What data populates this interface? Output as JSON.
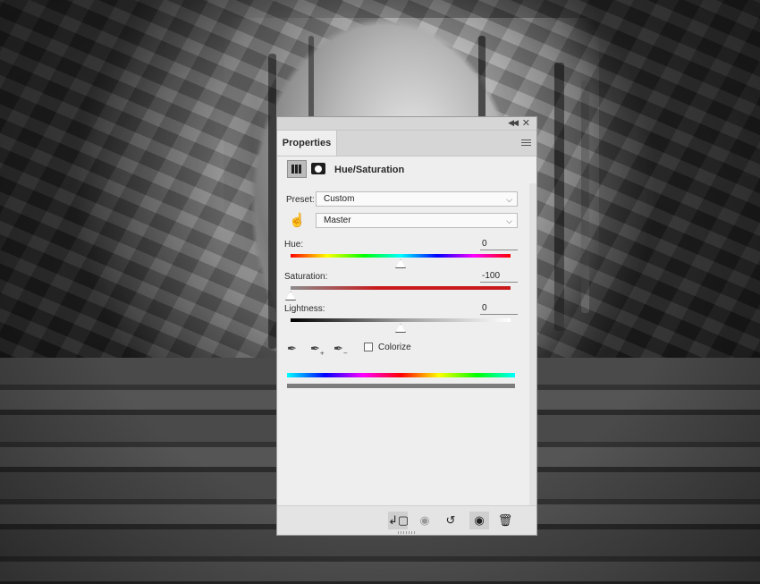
{
  "panel": {
    "tab_label": "Properties",
    "adjustment_title": "Hue/Saturation",
    "preset": {
      "label": "Preset:",
      "value": "Custom"
    },
    "channel": {
      "value": "Master"
    },
    "hue": {
      "label": "Hue:",
      "value": "0",
      "position": 0.5
    },
    "saturation": {
      "label": "Saturation:",
      "value": "-100",
      "position": 0.0
    },
    "lightness": {
      "label": "Lightness:",
      "value": "0",
      "position": 0.5
    },
    "colorize": {
      "label": "Colorize",
      "checked": false
    },
    "icons": {
      "adjustment": "hue-saturation-layer-icon",
      "mask": "layer-mask-icon",
      "targeted_adjustment": "hand-icon",
      "eyedroppers": [
        "eyedropper-icon",
        "eyedropper-add-icon",
        "eyedropper-subtract-icon"
      ],
      "bottom": [
        "clip-to-layer-icon",
        "view-previous-state-icon",
        "reset-icon",
        "visibility-eye-icon",
        "trash-icon"
      ]
    },
    "colors": {
      "panel_bg": "#eeeeee",
      "saturation_track": "#c8191b"
    }
  }
}
